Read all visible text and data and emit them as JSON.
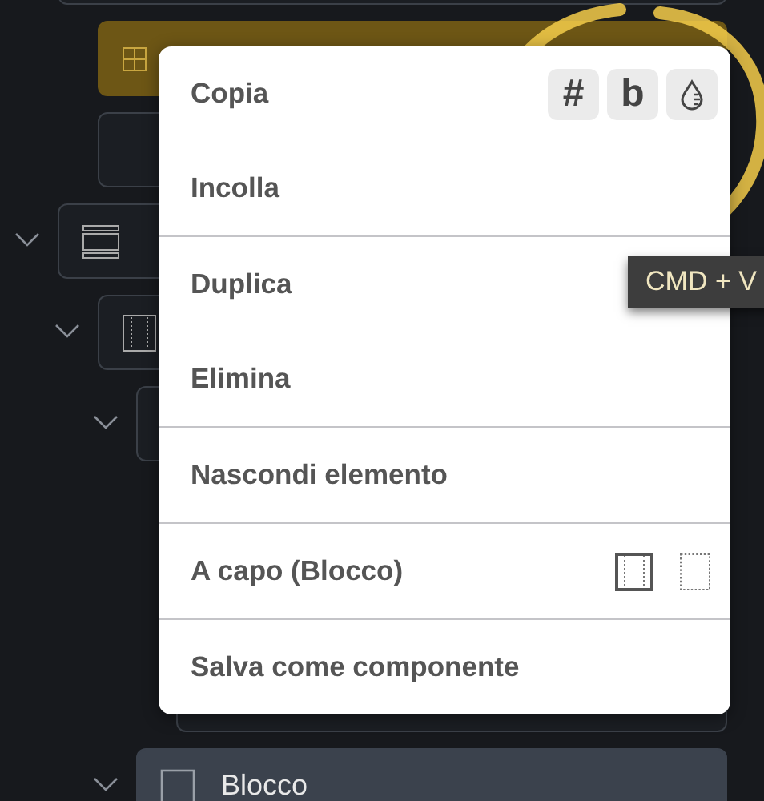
{
  "tree": [
    {
      "selected": false,
      "hovered": false,
      "children": [
        {
          "kind": "grid",
          "selected": true,
          "hovered": false
        },
        {
          "selected": false,
          "hovered": false
        }
      ]
    },
    {
      "kind": "section",
      "expanded": true,
      "selected": false,
      "hovered": false,
      "children": [
        {
          "kind": "columns",
          "expanded": true,
          "selected": false,
          "hovered": false,
          "children": [
            {
              "expanded": true,
              "selected": false,
              "hovered": false,
              "children": [
                {
                  "selected": false,
                  "hovered": false
                }
              ]
            },
            {
              "kind": "block",
              "label": "Blocco",
              "expanded": true,
              "selected": false,
              "hovered": true
            }
          ]
        }
      ]
    }
  ],
  "context_menu": {
    "groups": [
      [
        {
          "label": "Copia",
          "chips": [
            {
              "kind": "text",
              "text": "#"
            },
            {
              "kind": "text",
              "text": "b"
            },
            {
              "kind": "drop"
            }
          ]
        },
        {
          "label": "Incolla"
        }
      ],
      [
        {
          "label": "Duplica"
        },
        {
          "label": "Elimina"
        }
      ],
      [
        {
          "label": "Nascondi elemento"
        }
      ],
      [
        {
          "label": "A capo (Blocco)",
          "options": [
            {
              "kind": "solid",
              "selected": true
            },
            {
              "kind": "dotted",
              "selected": false
            }
          ]
        }
      ],
      [
        {
          "label": "Salva come componente"
        }
      ]
    ]
  },
  "tooltip": {
    "text": "CMD + V"
  },
  "annotation": {
    "kind": "circle"
  }
}
